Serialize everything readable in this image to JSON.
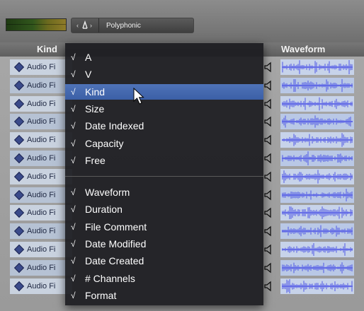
{
  "toolbar": {
    "mode_icon": "tuning-fork-icon",
    "mode_label": "Polyphonic"
  },
  "columns": {
    "kind": "Kind",
    "waveform": "Waveform"
  },
  "rows": [
    {
      "kind": "Audio Fi"
    },
    {
      "kind": "Audio Fi"
    },
    {
      "kind": "Audio Fi"
    },
    {
      "kind": "Audio Fi"
    },
    {
      "kind": "Audio Fi"
    },
    {
      "kind": "Audio Fi"
    },
    {
      "kind": "Audio Fi"
    },
    {
      "kind": "Audio Fi"
    },
    {
      "kind": "Audio Fi"
    },
    {
      "kind": "Audio Fi"
    },
    {
      "kind": "Audio Fi"
    },
    {
      "kind": "Audio Fi"
    },
    {
      "kind": "Audio Fi"
    }
  ],
  "menu": {
    "check": "√",
    "group1": [
      {
        "label": "A",
        "checked": true
      },
      {
        "label": "V",
        "checked": true
      },
      {
        "label": "Kind",
        "checked": true,
        "highlighted": true
      },
      {
        "label": "Size",
        "checked": true
      },
      {
        "label": "Date Indexed",
        "checked": true
      },
      {
        "label": "Capacity",
        "checked": true
      },
      {
        "label": "Free",
        "checked": true
      }
    ],
    "group2": [
      {
        "label": "Waveform",
        "checked": true
      },
      {
        "label": "Duration",
        "checked": true
      },
      {
        "label": "File Comment",
        "checked": true
      },
      {
        "label": "Date Modified",
        "checked": true
      },
      {
        "label": "Date Created",
        "checked": true
      },
      {
        "label": "# Channels",
        "checked": true
      },
      {
        "label": "Format",
        "checked": true
      }
    ]
  },
  "colors": {
    "menu_bg": "#1c1c20",
    "highlight": "#4a6db3",
    "waveform": "#4f57e6",
    "row_bg": "#c9d2df"
  }
}
